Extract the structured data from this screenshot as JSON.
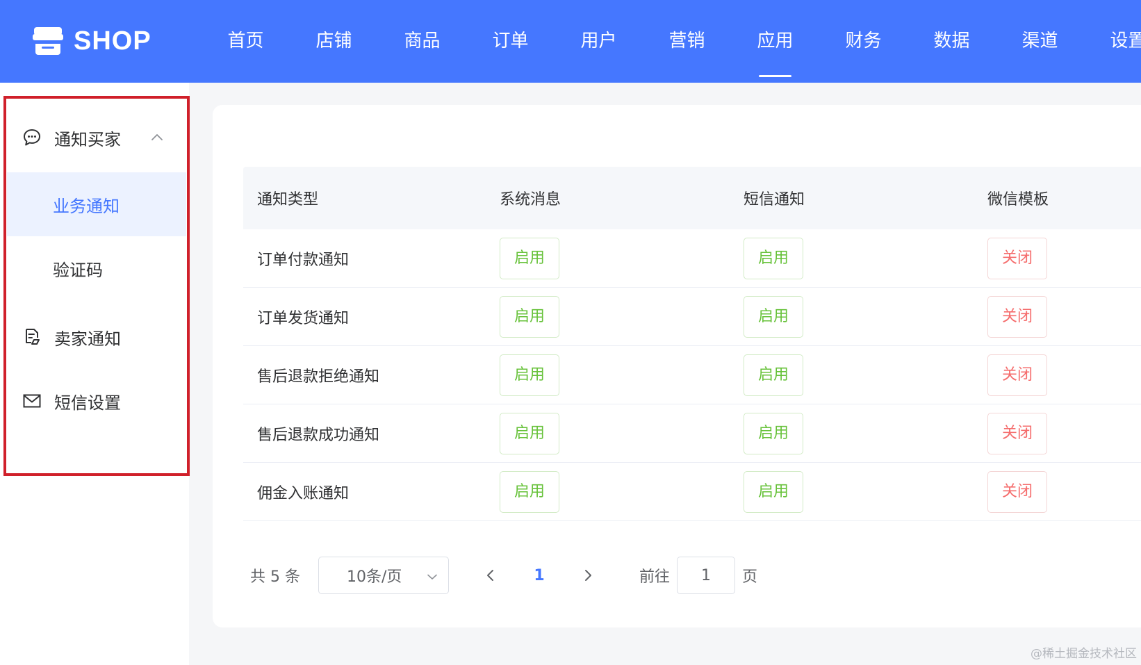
{
  "colors": {
    "brand": "#4577ff",
    "annotation": "#d0202a",
    "enabled": "#67c23a",
    "disabled": "#f56c6c"
  },
  "header": {
    "logo_text": "SHOP",
    "logo_icon": "store-icon",
    "nav": [
      {
        "label": "首页",
        "active": false
      },
      {
        "label": "店铺",
        "active": false
      },
      {
        "label": "商品",
        "active": false
      },
      {
        "label": "订单",
        "active": false
      },
      {
        "label": "用户",
        "active": false
      },
      {
        "label": "营销",
        "active": false
      },
      {
        "label": "应用",
        "active": true
      },
      {
        "label": "财务",
        "active": false
      },
      {
        "label": "数据",
        "active": false
      },
      {
        "label": "渠道",
        "active": false
      },
      {
        "label": "设置",
        "active": false
      }
    ]
  },
  "sidebar": {
    "groups": [
      {
        "label": "通知买家",
        "icon": "chat-bubble-icon",
        "expanded": true,
        "children": [
          {
            "label": "业务通知",
            "active": true
          },
          {
            "label": "验证码",
            "active": false
          }
        ]
      },
      {
        "label": "卖家通知",
        "icon": "seller-notice-icon"
      },
      {
        "label": "短信设置",
        "icon": "mail-icon"
      }
    ]
  },
  "table": {
    "columns": [
      "通知类型",
      "系统消息",
      "短信通知",
      "微信模板"
    ],
    "rows": [
      {
        "type": "订单付款通知",
        "system": "启用",
        "sms": "启用",
        "wechat": "关闭"
      },
      {
        "type": "订单发货通知",
        "system": "启用",
        "sms": "启用",
        "wechat": "关闭"
      },
      {
        "type": "售后退款拒绝通知",
        "system": "启用",
        "sms": "启用",
        "wechat": "关闭"
      },
      {
        "type": "售后退款成功通知",
        "system": "启用",
        "sms": "启用",
        "wechat": "关闭"
      },
      {
        "type": "佣金入账通知",
        "system": "启用",
        "sms": "启用",
        "wechat": "关闭"
      }
    ]
  },
  "pagination": {
    "total_text": "共 5 条",
    "page_size": "10条/页",
    "current_page": "1",
    "goto_label": "前往",
    "goto_value": "1",
    "goto_unit": "页"
  },
  "watermark": "@稀土掘金技术社区"
}
